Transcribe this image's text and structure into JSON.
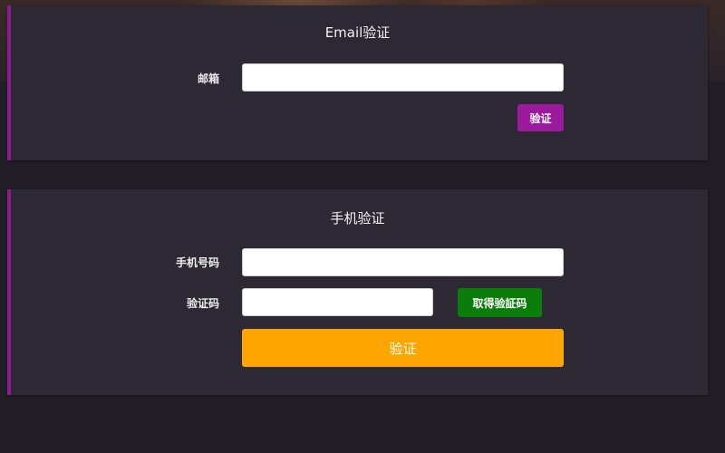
{
  "email_section": {
    "title": "Email验证",
    "email_label": "邮箱",
    "email_value": "",
    "verify_button": "验证"
  },
  "phone_section": {
    "title": "手机验证",
    "phone_label": "手机号码",
    "phone_value": "",
    "code_label": "验证码",
    "code_value": "",
    "get_code_button": "取得验証码",
    "verify_button": "验证"
  },
  "colors": {
    "accent_purple": "#9c1a9e",
    "get_code_green": "#0b7d0b",
    "verify_orange": "#ffa500",
    "panel_bg": "#2c2935",
    "page_bg": "#211e26"
  }
}
